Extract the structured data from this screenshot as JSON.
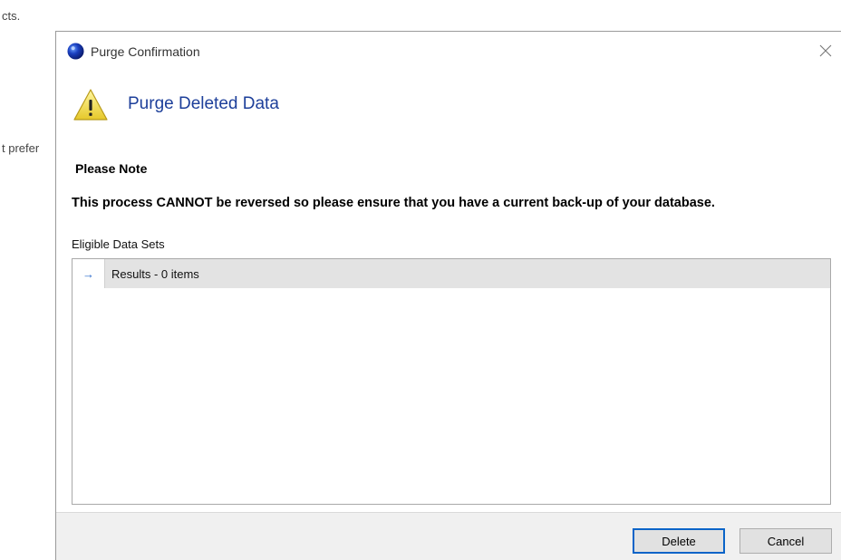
{
  "background": {
    "text_top": "cts.",
    "text_mid": "t prefer"
  },
  "dialog": {
    "title": "Purge Confirmation",
    "heading": "Purge Deleted Data",
    "note_title": "Please Note",
    "note_body": "This process CANNOT be reversed so please ensure that you have a current back-up of your database.",
    "sets_label": "Eligible Data Sets",
    "grid": {
      "rows": [
        {
          "indicator": "→",
          "text": "Results - 0 items"
        }
      ]
    },
    "buttons": {
      "delete": "Delete",
      "cancel": "Cancel"
    }
  },
  "colors": {
    "heading": "#1d3f9a",
    "accent": "#0a64c8",
    "warning": "#f3e24a"
  },
  "icons": {
    "app": "app-logo-icon",
    "close": "close-icon",
    "warning": "warning-icon",
    "row_indicator": "arrow-right-icon"
  }
}
